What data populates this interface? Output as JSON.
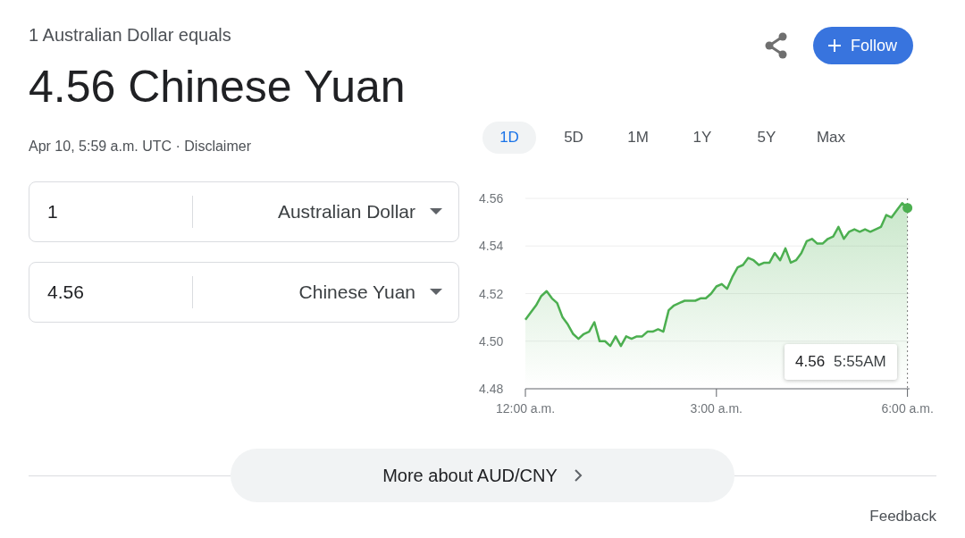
{
  "header": {
    "subtitle": "1 Australian Dollar equals",
    "headline": "4.56 Chinese Yuan",
    "timestamp": "Apr 10, 5:59 a.m. UTC · ",
    "disclaimer": "Disclaimer"
  },
  "follow_button": {
    "label": "Follow"
  },
  "converter": [
    {
      "amount": "1",
      "currency": "Australian Dollar"
    },
    {
      "amount": "4.56",
      "currency": "Chinese Yuan"
    }
  ],
  "ranges": [
    {
      "label": "1D",
      "selected": true
    },
    {
      "label": "5D",
      "selected": false
    },
    {
      "label": "1M",
      "selected": false
    },
    {
      "label": "1Y",
      "selected": false
    },
    {
      "label": "5Y",
      "selected": false
    },
    {
      "label": "Max",
      "selected": false
    }
  ],
  "chart": {
    "chart_data": {
      "type": "area",
      "x": [
        0,
        5,
        10,
        15,
        20,
        25,
        30,
        35,
        40,
        45,
        50,
        55,
        60,
        65,
        70,
        75,
        80,
        85,
        90,
        95,
        100,
        105,
        110,
        115,
        120,
        125,
        130,
        135,
        140,
        145,
        150,
        155,
        160,
        165,
        170,
        175,
        180,
        185,
        190,
        195,
        200,
        205,
        210,
        215,
        220,
        225,
        230,
        235,
        240,
        245,
        250,
        255,
        260,
        265,
        270,
        275,
        280,
        285,
        290,
        295,
        300,
        305,
        310,
        315,
        320,
        325,
        330,
        335,
        340,
        345,
        350,
        355,
        360
      ],
      "grid": true,
      "series": [
        {
          "color": "#4caf50",
          "values": [
            4.509,
            4.512,
            4.515,
            4.519,
            4.521,
            4.518,
            4.516,
            4.51,
            4.507,
            4.503,
            4.501,
            4.503,
            4.504,
            4.508,
            4.5,
            4.5,
            4.498,
            4.502,
            4.498,
            4.502,
            4.501,
            4.502,
            4.502,
            4.504,
            4.504,
            4.505,
            4.504,
            4.513,
            4.515,
            4.516,
            4.517,
            4.517,
            4.517,
            4.518,
            4.518,
            4.52,
            4.523,
            4.524,
            4.522,
            4.527,
            4.531,
            4.532,
            4.535,
            4.534,
            4.532,
            4.533,
            4.533,
            4.537,
            4.534,
            4.539,
            4.533,
            4.534,
            4.537,
            4.542,
            4.543,
            4.541,
            4.541,
            4.543,
            4.544,
            4.548,
            4.543,
            4.546,
            4.547,
            4.546,
            4.547,
            4.546,
            4.547,
            4.548,
            4.553,
            4.552,
            4.555,
            4.558,
            4.556
          ]
        }
      ],
      "xlim": [
        0,
        362
      ],
      "ylim": [
        4.48,
        4.56
      ],
      "xticks": [
        {
          "value": 0,
          "label": "12:00 a.m."
        },
        {
          "value": 180,
          "label": "3:00 a.m."
        },
        {
          "value": 360,
          "label": "6:00 a.m."
        }
      ],
      "yticks": [
        {
          "value": 4.56,
          "label": "4.56"
        },
        {
          "value": 4.54,
          "label": "4.54"
        },
        {
          "value": 4.52,
          "label": "4.52"
        },
        {
          "value": 4.5,
          "label": "4.50"
        },
        {
          "value": 4.48,
          "label": "4.48"
        }
      ]
    },
    "tooltip": {
      "value": "4.56",
      "time": "5:55AM"
    }
  },
  "more_button": {
    "label": "More about AUD/CNY"
  },
  "feedback": "Feedback"
}
